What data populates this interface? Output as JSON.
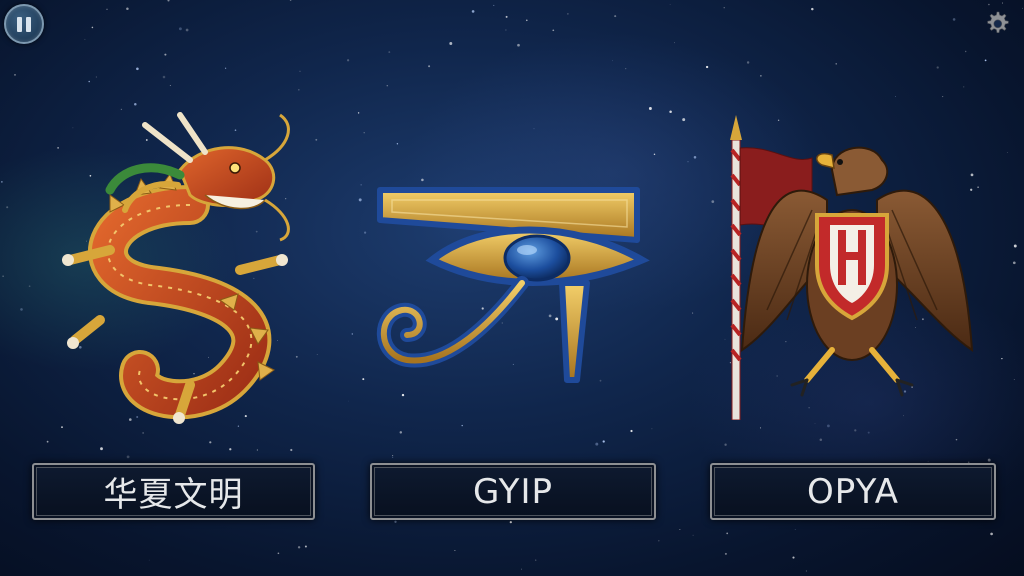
{
  "hud": {
    "pause_icon": "pause-icon",
    "settings_icon": "gear-icon"
  },
  "civilizations": [
    {
      "label": "华夏文明",
      "emblem": "dragon"
    },
    {
      "label": "GYIP",
      "emblem": "eye-of-horus"
    },
    {
      "label": "OPYA",
      "emblem": "eagle-with-banner"
    }
  ],
  "colors": {
    "background": "#0b1d3c",
    "button_border": "#8d8f92",
    "button_text": "#e6e8ea",
    "gold": "#d7a63a",
    "lapis": "#1f4a9a",
    "dragon_red": "#c24a22",
    "eagle_brown": "#6b3f22",
    "shield_red": "#c22a2a"
  }
}
